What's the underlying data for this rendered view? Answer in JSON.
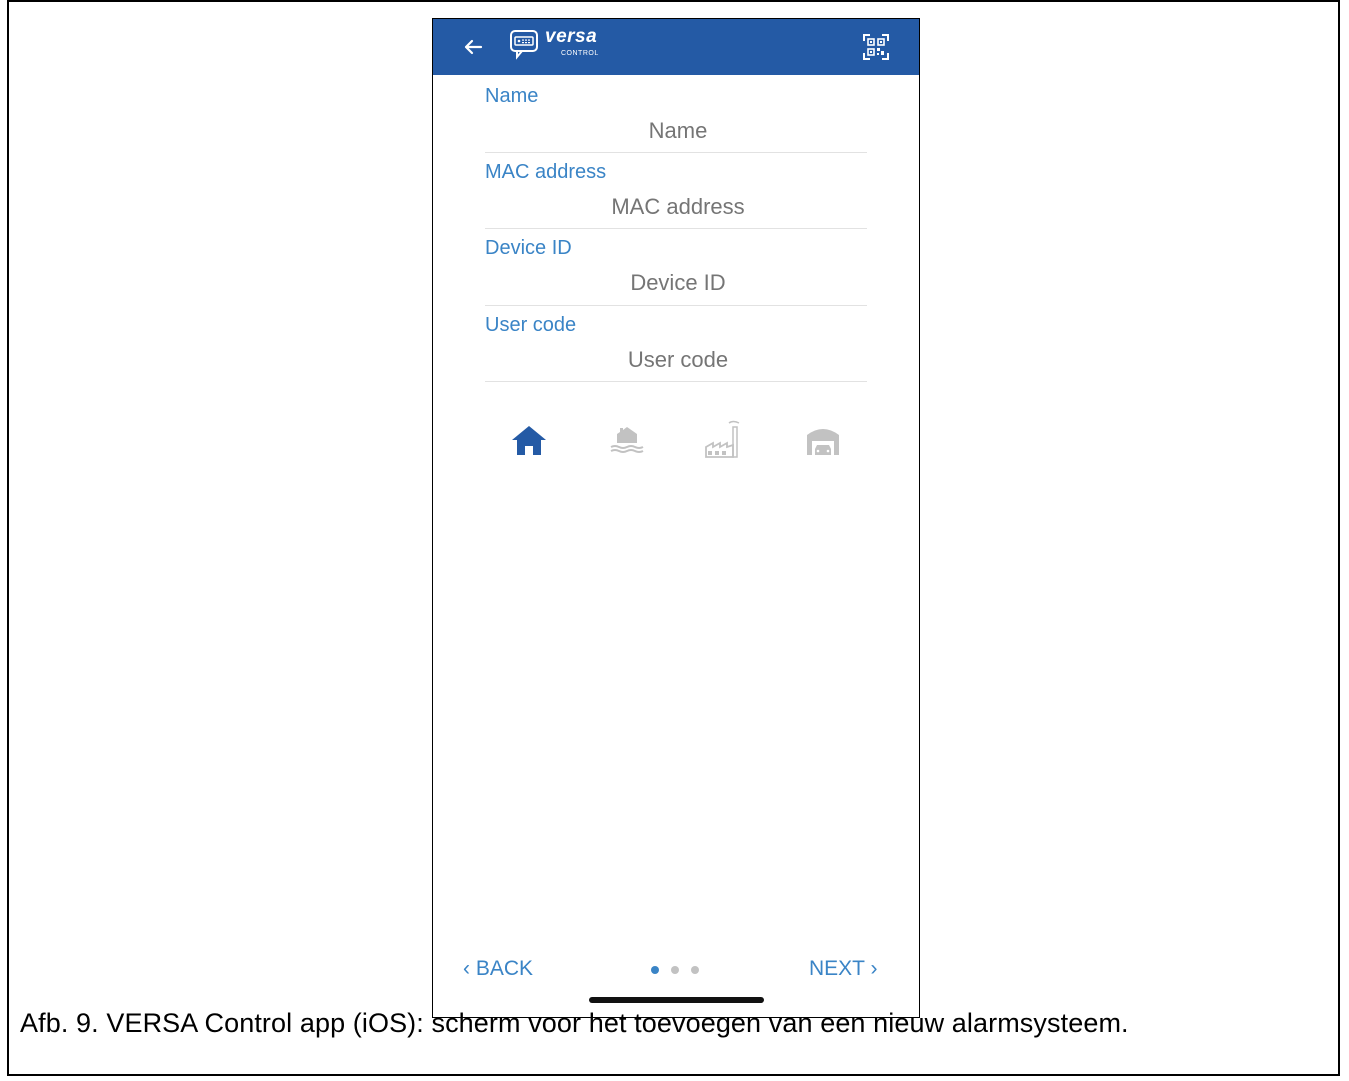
{
  "app": {
    "logo_text": "versa",
    "logo_subtext": "CONTROL",
    "accent_color": "#245aa5",
    "link_color": "#3a84c6"
  },
  "form": {
    "fields": [
      {
        "label": "Name",
        "placeholder": "Name"
      },
      {
        "label": "MAC address",
        "placeholder": "MAC address"
      },
      {
        "label": "Device ID",
        "placeholder": "Device ID"
      },
      {
        "label": "User code",
        "placeholder": "User code"
      }
    ]
  },
  "property_types": [
    {
      "icon": "house-icon",
      "selected": true
    },
    {
      "icon": "waterfront-house-icon",
      "selected": false
    },
    {
      "icon": "factory-icon",
      "selected": false
    },
    {
      "icon": "garage-icon",
      "selected": false
    }
  ],
  "footer": {
    "back_label": "BACK",
    "next_label": "NEXT",
    "page_count": 3,
    "current_page": 1
  },
  "caption": "Afb. 9. VERSA Control app (iOS): scherm voor het toevoegen van een nieuw alarmsysteem."
}
